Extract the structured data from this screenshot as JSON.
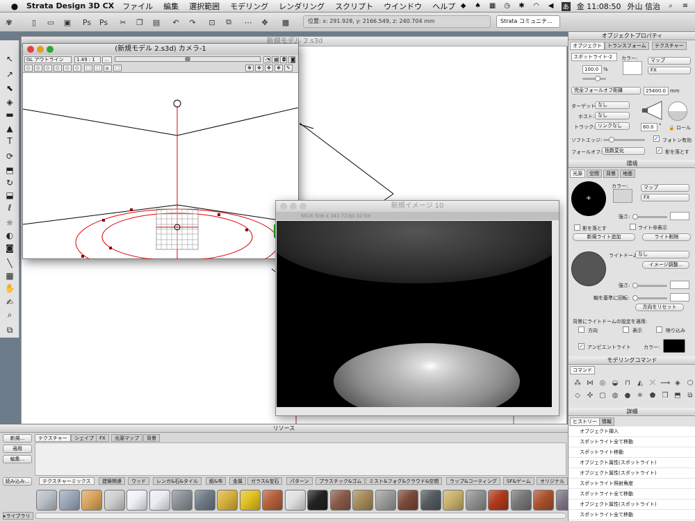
{
  "menubar": {
    "app_name": "Strata Design 3D CX",
    "items": [
      "ファイル",
      "編集",
      "選択範囲",
      "モデリング",
      "レンダリング",
      "スクリプト",
      "ウインドウ",
      "ヘルプ"
    ],
    "status_icons": [
      "dropbox-icon",
      "evernote-icon",
      "calendar-icon",
      "time-machine-icon",
      "bluetooth-icon",
      "wifi-icon",
      "volume-icon",
      "input-method-icon"
    ],
    "input_label": "あ",
    "clock": "金 11:08:50",
    "user": "外山 信治"
  },
  "toolbar": {
    "position": "位置: x: 291.928, y: 2166.549, z: 240.704 mm",
    "community": "Strata コミュニテ…"
  },
  "workspace": {
    "title": "新規モデル 2.s3d"
  },
  "camera_window": {
    "title": "(新規モデル 2.s3d) カメラ-1",
    "render_mode": "GL アウトライン",
    "scale": "1.49 : 1",
    "ellipsis": "..."
  },
  "render_window": {
    "title": "新規イメージ 10",
    "info": "681K   508 x 343   72dpi   32-bit"
  },
  "object_properties": {
    "title": "オブジェクトプロパティ",
    "tabs": [
      "オブジェクト",
      "トランスフォーム",
      "テクスチャー"
    ],
    "object_name": "スポットライト-2",
    "color_label": "カラー:",
    "map_select": "マップ",
    "fx_select": "FX",
    "intensity": "100.0",
    "percent_unit": "%",
    "falloff_select": "完全フォールオフ距離",
    "falloff_value": "25400.0",
    "falloff_unit": "mm",
    "target_label": "ターゲット:",
    "target_value": "なし",
    "host_label": "ホスト:",
    "host_value": "なし",
    "track_label": "トラック:",
    "track_value": "リンクなし",
    "angle_value": "60.0",
    "degree_unit": "°",
    "roll_label": "ロール",
    "soft_edge_label": "ソフトエッジ:",
    "photon_label": "フォトン有効",
    "falloff_label": "フォールオフ:",
    "falloff_mode": "指数変化",
    "shadow_label": "影を落とす"
  },
  "environment": {
    "title": "環境",
    "tabs": [
      "光源",
      "空間",
      "背景",
      "地面"
    ],
    "color_label": "カラー:",
    "map_select": "マップ",
    "fx_select": "FX",
    "strength_label": "強さ:",
    "cast_shadow": "影を落とす",
    "hide_light": "ライト非表示",
    "add_light": "新規ライト追加",
    "delete_light": "ライト削除",
    "light_dome_label": "ライトドーム:",
    "light_dome_value": "なし",
    "image_adjust": "イメージ調整...",
    "axis_rotate_label": "軸を基準に回転:",
    "reset_direction": "方向をリセット",
    "bg_apply_label": "背景にライトドームの設定を適用:",
    "direction": "方向",
    "show": "表示",
    "reflect": "映り込み",
    "ambient_label": "アンビエントライト",
    "ambient_color_label": "カラー:"
  },
  "modeling_commands": {
    "title": "モデリングコマンド",
    "tab": "コマンド"
  },
  "details": {
    "title": "詳細",
    "tabs": [
      "ヒストリー",
      "情報"
    ],
    "history": [
      "オブジェクト挿入",
      "スポットライト全て移動",
      "スポットライト移動",
      "オブジェクト属性(スポットライト)",
      "オブジェクト属性(スポットライト)",
      "スポットライト照射角度",
      "スポットライト全て移動",
      "オブジェクト属性(スポットライト)",
      "スポットライト全て移動"
    ]
  },
  "resources": {
    "title": "リソース",
    "tabs": [
      "テクスチャー",
      "シェイプ",
      "FX",
      "光源マップ",
      "背景"
    ],
    "buttons": [
      "新規...",
      "適用",
      "編集...",
      "読み込み..."
    ],
    "category_tabs": [
      "テクスチャーミックス",
      "建築関連",
      "ウッド",
      "レンガ&石&タイル",
      "紙&布",
      "金属",
      "ガラス&宝石",
      "パターン",
      "プラスチック&ゴム",
      "ミスト&フォグ&クラウド&空間",
      "ラップ&コーティング",
      "SF&ゲーム",
      "オリジナル"
    ],
    "library_label": "▸ライブラリ",
    "swatch_colors": [
      "#b8bfc6",
      "#9aa6b8",
      "#d9a35a",
      "#cfcfcf",
      "#eef2f8",
      "#e9edf3",
      "#8a8f96",
      "#6f7a86",
      "#d7b13c",
      "#e1c020",
      "#b4603a",
      "#e0e0e0",
      "#222222",
      "#8b5a48",
      "#a58a5a",
      "#9a9a9a",
      "#7a4a3a",
      "#555a60",
      "#c7b06a",
      "#8f8f8f",
      "#b03a1a",
      "#777777",
      "#a8522e",
      "#7a7080"
    ]
  }
}
